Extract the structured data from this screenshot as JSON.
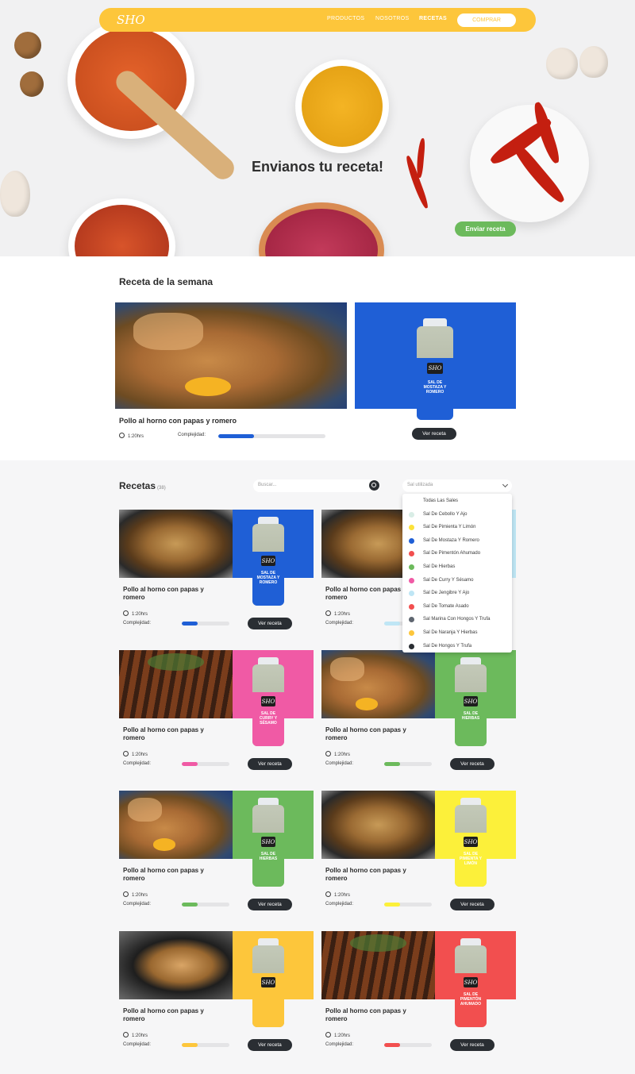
{
  "nav": {
    "logo": "SHO",
    "links": [
      "PRODUCTOS",
      "NOSOTROS",
      "RECETAS"
    ],
    "cta": "COMPRAR"
  },
  "hero": {
    "title": "Envianos tu receta!",
    "cta": "Enviar receta"
  },
  "weekly": {
    "title": "Receta de la semana",
    "recipe": {
      "name": "Pollo al horno con papas y romero",
      "time": "1:20hrs",
      "complexity_label": "Complejidad:",
      "complexity": 0.33,
      "bar_color": "#1f5fd6"
    },
    "product": {
      "salt": "SAL DE MOSTAZA Y ROMERO",
      "color": "#1f5fd6",
      "cta": "Ver receta"
    }
  },
  "recipes": {
    "title": "Recetas",
    "count": "(38)",
    "search_placeholder": "Buscar...",
    "filter_placeholder": "Sal utilizada",
    "filter_options": [
      {
        "label": "Todas Las Sales",
        "color": ""
      },
      {
        "label": "Sal De Cebollo Y Ajo",
        "color": "#d9ede6"
      },
      {
        "label": "Sal De Pimienta Y Limón",
        "color": "#fce23a"
      },
      {
        "label": "Sal De Mostaza Y Romero",
        "color": "#1f5fd6"
      },
      {
        "label": "Sal De Pimentón Ahumado",
        "color": "#f24f4f"
      },
      {
        "label": "Sal De Hierbas",
        "color": "#6cba5c"
      },
      {
        "label": "Sal De Curry Y Sésamo",
        "color": "#f05aa5"
      },
      {
        "label": "Sal De Jengibre Y Ajo",
        "color": "#bfe6f5"
      },
      {
        "label": "Sal De Tomate Asado",
        "color": "#f24f4f"
      },
      {
        "label": "Sal Marina Con Hongos Y Trufa",
        "color": "#5f6670"
      },
      {
        "label": "Sal De Naranja Y Hierbas",
        "color": "#fdc63b"
      },
      {
        "label": "Sal De Hongos Y Trufa",
        "color": "#2a2e33"
      }
    ],
    "cards": [
      {
        "name": "Pollo al horno con papas y romero",
        "time": "1:20hrs",
        "complexity_label": "Complejidad:",
        "complexity": 0.33,
        "color": "#1f5fd6",
        "salt": "SAL DE MOSTAZA Y ROMERO",
        "cta": "Ver receta"
      },
      {
        "name": "Pollo al horno con papas y romero",
        "time": "1:20hrs",
        "complexity_label": "Complejidad:",
        "complexity": 0.33,
        "color": "#bfe6f5",
        "salt": "",
        "cta": "Ver receta"
      },
      {
        "name": "Pollo al horno con papas y romero",
        "time": "1:20hrs",
        "complexity_label": "Complejidad:",
        "complexity": 0.33,
        "color": "#f05aa5",
        "salt": "SAL DE CURRY Y SÉSAMO",
        "cta": "Ver receta"
      },
      {
        "name": "Pollo al horno con papas y romero",
        "time": "1:20hrs",
        "complexity_label": "Complejidad:",
        "complexity": 0.33,
        "color": "#6cba5c",
        "salt": "SAL DE HIERBAS",
        "cta": "Ver receta"
      },
      {
        "name": "Pollo al horno con papas y romero",
        "time": "1:20hrs",
        "complexity_label": "Complejidad:",
        "complexity": 0.33,
        "color": "#6cba5c",
        "salt": "SAL DE HIERBAS",
        "cta": "Ver receta"
      },
      {
        "name": "Pollo al horno con papas y romero",
        "time": "1:20hrs",
        "complexity_label": "Complejidad:",
        "complexity": 0.33,
        "color": "#fcf03a",
        "salt": "SAL DE PIMIENTA Y LIMÓN",
        "cta": "Ver receta"
      },
      {
        "name": "Pollo al horno con papas y romero",
        "time": "1:20hrs",
        "complexity_label": "Complejidad:",
        "complexity": 0.33,
        "color": "#fdc63b",
        "salt": "",
        "cta": "Ver receta"
      },
      {
        "name": "Pollo al horno con papas y romero",
        "time": "1:20hrs",
        "complexity_label": "Complejidad:",
        "complexity": 0.33,
        "color": "#f24f4f",
        "salt": "SAL DE PIMENTÓN AHUMADO",
        "cta": "Ver receta"
      }
    ]
  }
}
